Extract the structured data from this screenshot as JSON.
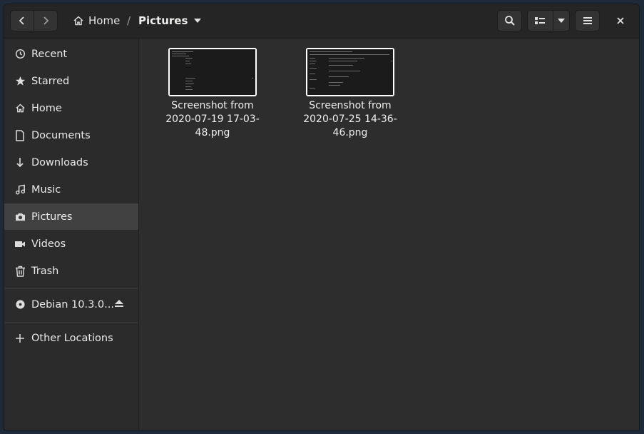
{
  "header": {
    "back_icon": "chevron-left-icon",
    "forward_icon": "chevron-right-icon",
    "breadcrumb": {
      "home_label": "Home",
      "separator": "/",
      "current_label": "Pictures"
    }
  },
  "sidebar": {
    "items": [
      {
        "label": "Recent",
        "icon": "clock-icon"
      },
      {
        "label": "Starred",
        "icon": "star-icon"
      },
      {
        "label": "Home",
        "icon": "home-icon"
      },
      {
        "label": "Documents",
        "icon": "document-icon"
      },
      {
        "label": "Downloads",
        "icon": "download-icon"
      },
      {
        "label": "Music",
        "icon": "music-icon"
      },
      {
        "label": "Pictures",
        "icon": "camera-icon",
        "active": true
      },
      {
        "label": "Videos",
        "icon": "video-icon"
      },
      {
        "label": "Trash",
        "icon": "trash-icon"
      }
    ],
    "volume": {
      "label": "Debian 10.3.0...",
      "icon": "disc-icon",
      "action_icon": "eject-icon"
    },
    "other": {
      "label": "Other Locations",
      "icon": "plus-icon"
    }
  },
  "files": [
    {
      "name": "Screenshot from 2020-07-19 17-03-48.png"
    },
    {
      "name": "Screenshot from 2020-07-25 14-36-46.png"
    }
  ],
  "colors": {
    "background": "#2d2d2d",
    "sidebar_active": "#414141",
    "headerbar": "#252525"
  }
}
